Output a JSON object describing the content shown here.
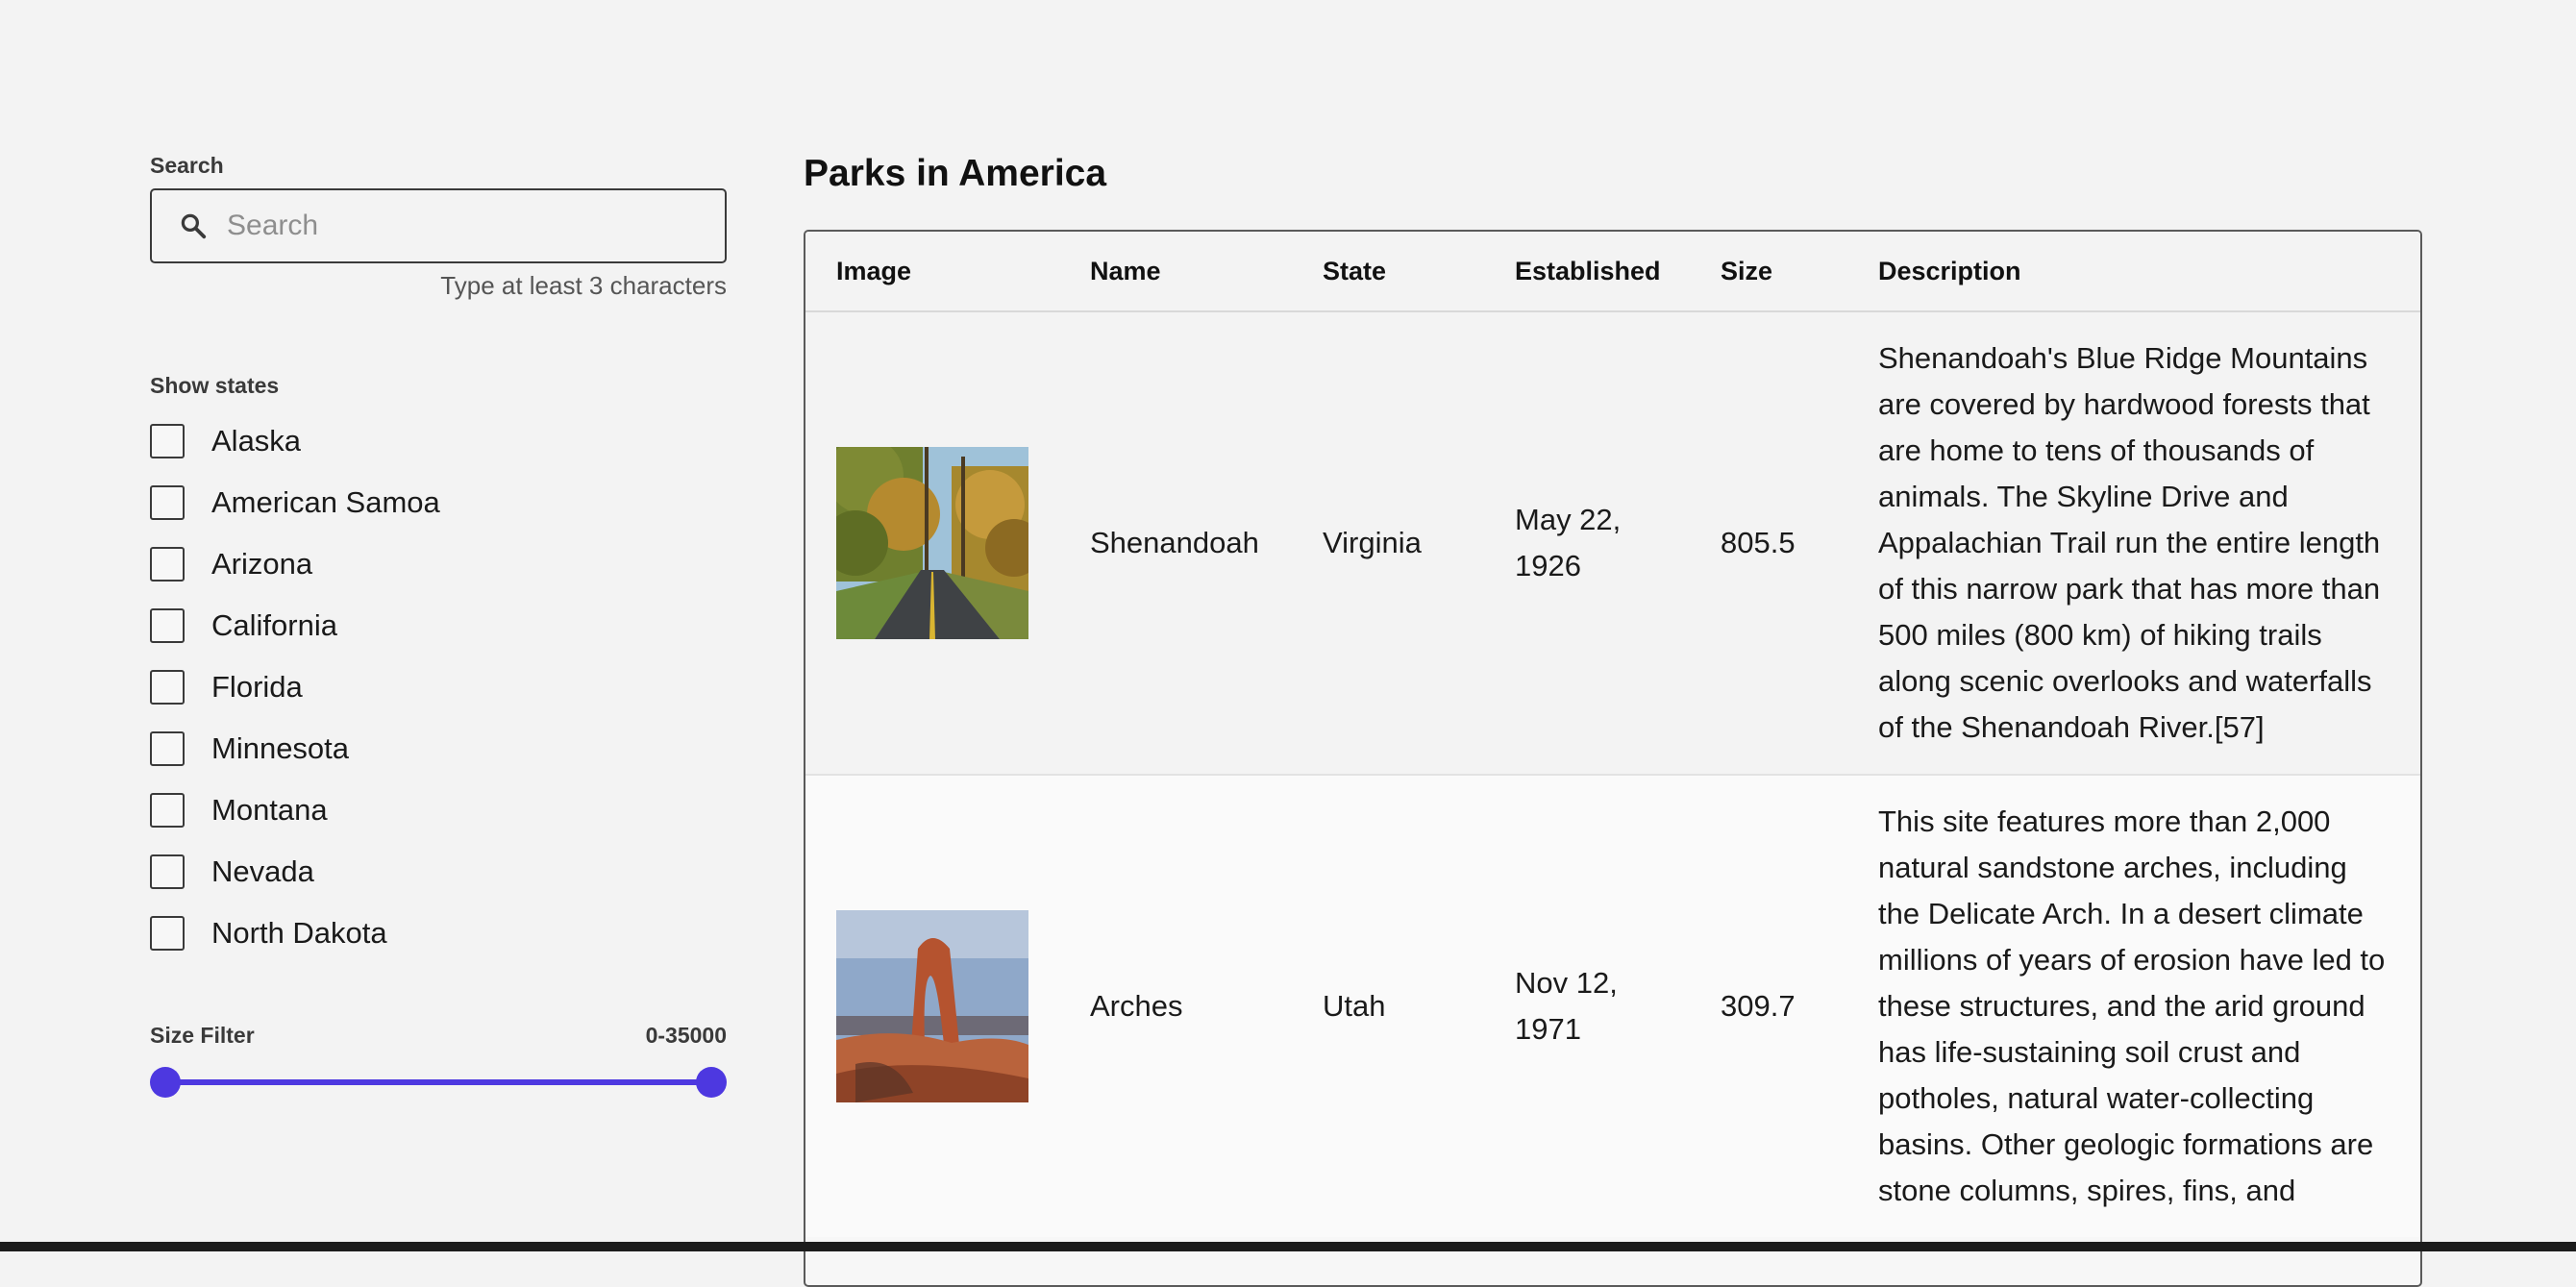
{
  "sidebar": {
    "search": {
      "label": "Search",
      "placeholder": "Search",
      "value": "",
      "helper": "Type at least 3 characters"
    },
    "states": {
      "label": "Show states",
      "items": [
        {
          "label": "Alaska",
          "checked": false
        },
        {
          "label": "American Samoa",
          "checked": false
        },
        {
          "label": "Arizona",
          "checked": false
        },
        {
          "label": "California",
          "checked": false
        },
        {
          "label": "Florida",
          "checked": false
        },
        {
          "label": "Minnesota",
          "checked": false
        },
        {
          "label": "Montana",
          "checked": false
        },
        {
          "label": "Nevada",
          "checked": false
        },
        {
          "label": "North Dakota",
          "checked": false
        }
      ]
    },
    "size_filter": {
      "label": "Size Filter",
      "range_text": "0-35000",
      "min": 0,
      "max": 35000,
      "value_min": 0,
      "value_max": 35000
    }
  },
  "main": {
    "title": "Parks in America",
    "columns": [
      "Image",
      "Name",
      "State",
      "Established",
      "Size",
      "Description"
    ],
    "rows": [
      {
        "image": "autumn-forest-road",
        "name": "Shenandoah",
        "state": "Virginia",
        "established": "May 22, 1926",
        "size": "805.5",
        "description": "Shenandoah's Blue Ridge Mountains are covered by hardwood forests that are home to tens of thousands of animals. The Skyline Drive and Appalachian Trail run the entire length of this narrow park that has more than 500 miles (800 km) of hiking trails along scenic overlooks and waterfalls of the Shenandoah River.[57]"
      },
      {
        "image": "delicate-arch",
        "name": "Arches",
        "state": "Utah",
        "established": "Nov 12, 1971",
        "size": "309.7",
        "description": "This site features more than 2,000 natural sandstone arches, including the Delicate Arch. In a desert climate millions of years of erosion have led to these structures, and the arid ground has life-sustaining soil crust and potholes, natural water-collecting basins. Other geologic formations are stone columns, spires, fins, and"
      }
    ]
  },
  "colors": {
    "accent": "#4d38e0",
    "background": "#f3f3f3",
    "border": "#5a5a5a"
  },
  "icons": {
    "search": "search-icon"
  }
}
